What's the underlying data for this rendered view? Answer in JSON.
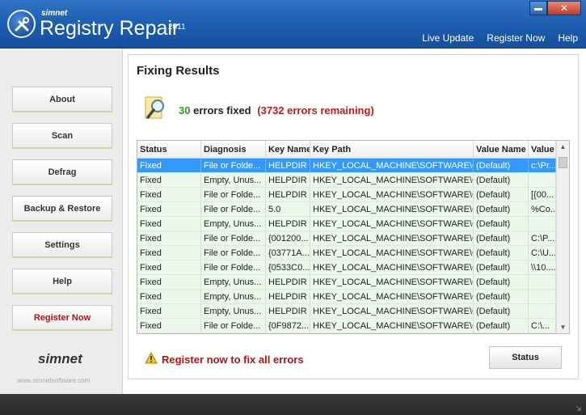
{
  "app": {
    "brand_small": "simnet",
    "title": "Registry Repair",
    "year": "2011",
    "links": [
      "Live Update",
      "Register Now",
      "Help"
    ]
  },
  "sidebar": {
    "items": [
      {
        "label": "About",
        "name": "about"
      },
      {
        "label": "Scan",
        "name": "scan"
      },
      {
        "label": "Defrag",
        "name": "defrag"
      },
      {
        "label": "Backup & Restore",
        "name": "backup-restore"
      },
      {
        "label": "Settings",
        "name": "settings"
      },
      {
        "label": "Help",
        "name": "help"
      },
      {
        "label": "Register Now",
        "name": "register-now"
      }
    ],
    "brand": "simnet",
    "url": "www.simnetsoftware.com"
  },
  "main": {
    "title": "Fixing Results",
    "fixed_count": "30",
    "fixed_label": "errors fixed",
    "remaining": "(3732 errors remaining)",
    "warning": "Register now to fix all errors",
    "status_button": "Status"
  },
  "table": {
    "columns": [
      "Status",
      "Diagnosis",
      "Key Name",
      "Key Path",
      "Value Name",
      "Value"
    ],
    "rows": [
      [
        "Fixed",
        "File or Folde...",
        "HELPDIR",
        "HKEY_LOCAL_MACHINE\\SOFTWARE\\C...",
        "(Default)",
        "c:\\Pr..."
      ],
      [
        "Fixed",
        "Empty, Unus...",
        "HELPDIR",
        "HKEY_LOCAL_MACHINE\\SOFTWARE\\C...",
        "(Default)",
        ""
      ],
      [
        "Fixed",
        "File or Folde...",
        "HELPDIR",
        "HKEY_LOCAL_MACHINE\\SOFTWARE\\C...",
        "(Default)",
        "[{00..."
      ],
      [
        "Fixed",
        "File or Folde...",
        "5.0",
        "HKEY_LOCAL_MACHINE\\SOFTWARE\\C...",
        "(Default)",
        "%Co..."
      ],
      [
        "Fixed",
        "Empty, Unus...",
        "HELPDIR",
        "HKEY_LOCAL_MACHINE\\SOFTWARE\\C...",
        "(Default)",
        ""
      ],
      [
        "Fixed",
        "File or Folde...",
        "{001200...",
        "HKEY_LOCAL_MACHINE\\SOFTWARE\\C...",
        "(Default)",
        "C:\\P..."
      ],
      [
        "Fixed",
        "File or Folde...",
        "{03771A...",
        "HKEY_LOCAL_MACHINE\\SOFTWARE\\C...",
        "(Default)",
        "C:\\U..."
      ],
      [
        "Fixed",
        "File or Folde...",
        "{0533C0...",
        "HKEY_LOCAL_MACHINE\\SOFTWARE\\C...",
        "(Default)",
        "\\\\10...."
      ],
      [
        "Fixed",
        "Empty, Unus...",
        "HELPDIR",
        "HKEY_LOCAL_MACHINE\\SOFTWARE\\C...",
        "(Default)",
        ""
      ],
      [
        "Fixed",
        "Empty, Unus...",
        "HELPDIR",
        "HKEY_LOCAL_MACHINE\\SOFTWARE\\C...",
        "(Default)",
        ""
      ],
      [
        "Fixed",
        "Empty, Unus...",
        "HELPDIR",
        "HKEY_LOCAL_MACHINE\\SOFTWARE\\C...",
        "(Default)",
        ""
      ],
      [
        "Fixed",
        "File or Folde...",
        "{0F9872...",
        "HKEY_LOCAL_MACHINE\\SOFTWARE\\C...",
        "(Default)",
        "C:\\..."
      ]
    ],
    "selected_row": 0
  },
  "colors": {
    "titlebar": "#1c5cae",
    "fixed_green": "#2f9a22",
    "remaining_red": "#c11a1a",
    "row_bg": "#eaf7ea",
    "selected_row": "#3399ff"
  }
}
